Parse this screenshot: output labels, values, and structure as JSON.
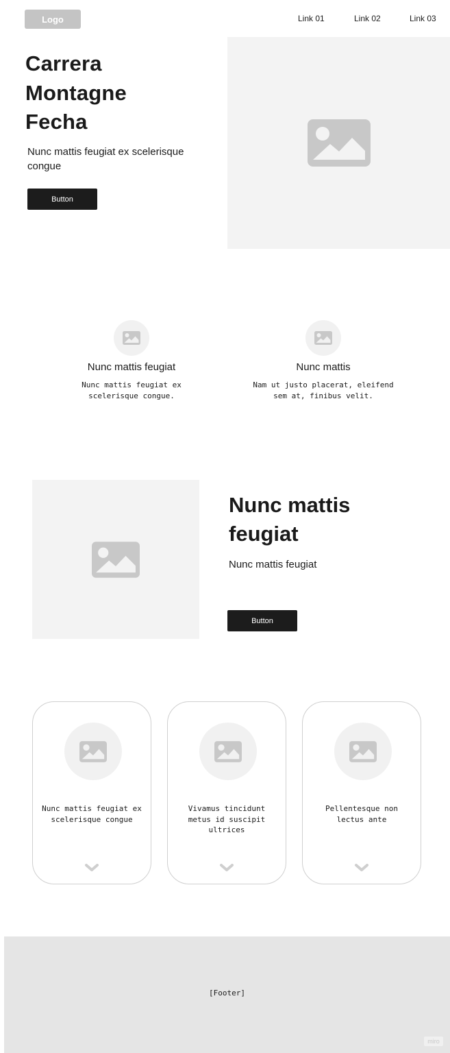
{
  "header": {
    "logo": "Logo",
    "links": [
      "Link 01",
      "Link 02",
      "Link 03"
    ]
  },
  "hero": {
    "title_lines": [
      "Carrera",
      "Montagne",
      "Fecha"
    ],
    "subtitle": "Nunc mattis feugiat ex scelerisque congue",
    "button": "Button",
    "image_icon": "image-icon"
  },
  "features": [
    {
      "icon": "image-icon",
      "title": "Nunc mattis feugiat",
      "text": "Nunc mattis feugiat ex scelerisque congue."
    },
    {
      "icon": "image-icon",
      "title": "Nunc mattis",
      "text": "Nam ut justo placerat, eleifend sem at, finibus velit."
    }
  ],
  "section3": {
    "title": "Nunc mattis feugiat",
    "subtitle": "Nunc mattis feugiat",
    "button": "Button",
    "image_icon": "image-icon"
  },
  "cards": [
    {
      "icon": "image-icon",
      "text": "Nunc mattis feugiat ex scelerisque congue",
      "chevron": "chevron-down-icon"
    },
    {
      "icon": "image-icon",
      "text": "Vivamus tincidunt metus id suscipit ultrices",
      "chevron": "chevron-down-icon"
    },
    {
      "icon": "image-icon",
      "text": "Pellentesque non lectus ante",
      "chevron": "chevron-down-icon"
    }
  ],
  "footer": {
    "label": "[Footer]",
    "badge": "miro"
  },
  "colors": {
    "placeholder_bg": "#f3f3f3",
    "icon_grey": "#c8c8c8",
    "button_bg": "#1c1c1c",
    "footer_bg": "#e5e5e5"
  }
}
